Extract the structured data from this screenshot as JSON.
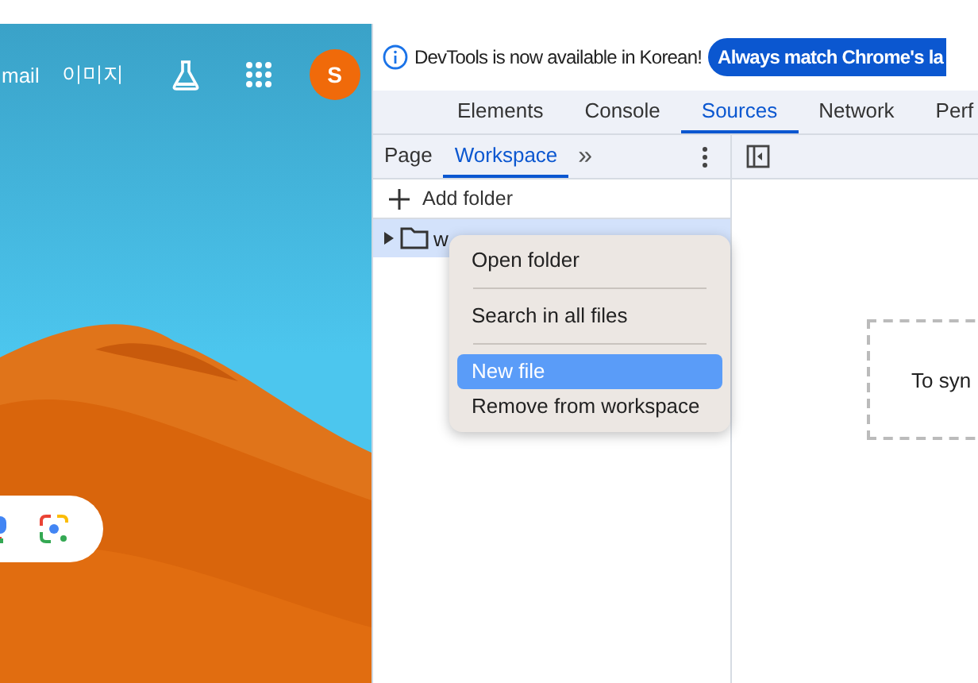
{
  "browser_page": {
    "header_links": [
      "mail",
      "이미지"
    ],
    "avatar": "S"
  },
  "devtools": {
    "notice": {
      "text": "DevTools is now available in Korean!",
      "button": "Always match Chrome's la"
    },
    "tabs": [
      {
        "label": "Elements",
        "selected": false
      },
      {
        "label": "Console",
        "selected": false
      },
      {
        "label": "Sources",
        "selected": true
      },
      {
        "label": "Network",
        "selected": false
      },
      {
        "label": "Perf",
        "selected": false
      }
    ],
    "sub_tabs": [
      {
        "label": "Page",
        "selected": false
      },
      {
        "label": "Workspace",
        "selected": true
      }
    ],
    "more": "»",
    "add_folder": "Add folder",
    "tree": [
      {
        "label": "w",
        "selected": true,
        "expanded": false
      }
    ],
    "context_menu": [
      {
        "label": "Open folder",
        "selected": false,
        "separator_after": true
      },
      {
        "label": "Search in all files",
        "selected": false,
        "separator_after": true
      },
      {
        "label": "New file",
        "selected": true,
        "separator_after": false
      },
      {
        "label": "Remove from workspace",
        "selected": false,
        "separator_after": false
      }
    ],
    "drop_hint": "To syn"
  }
}
